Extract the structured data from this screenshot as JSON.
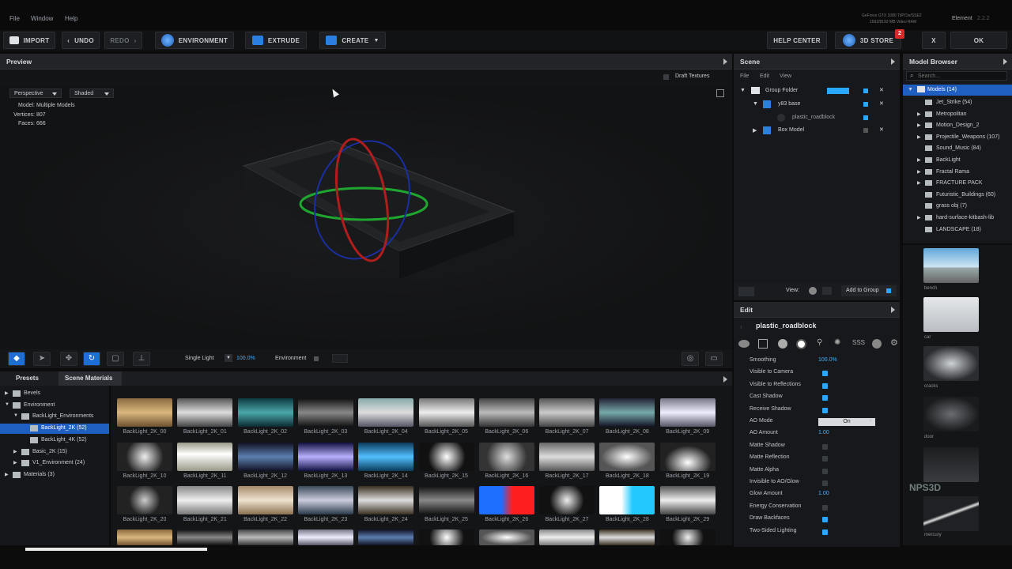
{
  "menu": [
    "File",
    "Window",
    "Help"
  ],
  "top_right": {
    "line1": "GeForce GTX 1080 Ti/PCIe/SSE2",
    "line2": "1592/8192 MB Video RAM",
    "app": "Element",
    "version": "2.2.2"
  },
  "toolbar": {
    "import": "IMPORT",
    "undo": "UNDO",
    "redo": "REDO",
    "environment": "ENVIRONMENT",
    "extrude": "EXTRUDE",
    "create": "CREATE",
    "help_center": "HELP CENTER",
    "store": "3D STORE",
    "store_badge": "2",
    "close": "X",
    "ok": "OK"
  },
  "preview": {
    "title": "Preview",
    "draft_textures": "Draft Textures",
    "view_mode": "Perspective",
    "shading": "Shaded",
    "stats": [
      {
        "k": "Model:",
        "v": "Multiple Models"
      },
      {
        "k": "Vertices:",
        "v": "807"
      },
      {
        "k": "Faces:",
        "v": "666"
      }
    ]
  },
  "viewbar": {
    "light": "Single Light",
    "light_pct": "100.0%",
    "env_label": "Environment"
  },
  "presets": {
    "tab_presets": "Presets",
    "tab_materials": "Scene Materials",
    "tree": [
      {
        "label": "Bevels",
        "depth": 0
      },
      {
        "label": "Environment",
        "depth": 0
      },
      {
        "label": "BackLight_Environments",
        "depth": 1
      },
      {
        "label": "BackLight_2K (52)",
        "depth": 2,
        "selected": true
      },
      {
        "label": "BackLight_4K (52)",
        "depth": 2
      },
      {
        "label": "Basic_2K (15)",
        "depth": 1
      },
      {
        "label": "V1_Environment (24)",
        "depth": 1
      },
      {
        "label": "Materials (3)",
        "depth": 0
      }
    ]
  },
  "thumbnails": [
    "BackLight_2K_00",
    "BackLight_2K_01",
    "BackLight_2K_02",
    "BackLight_2K_03",
    "BackLight_2K_04",
    "BackLight_2K_05",
    "BackLight_2K_06",
    "BackLight_2K_07",
    "BackLight_2K_08",
    "BackLight_2K_09",
    "BackLight_2K_10",
    "BackLight_2K_11",
    "BackLight_2K_12",
    "BackLight_2K_13",
    "BackLight_2K_14",
    "BackLight_2K_15",
    "BackLight_2K_16",
    "BackLight_2K_17",
    "BackLight_2K_18",
    "BackLight_2K_19",
    "BackLight_2K_20",
    "BackLight_2K_21",
    "BackLight_2K_22",
    "BackLight_2K_23",
    "BackLight_2K_24",
    "BackLight_2K_25",
    "BackLight_2K_26",
    "BackLight_2K_27",
    "BackLight_2K_28",
    "BackLight_2K_29"
  ],
  "scene": {
    "title": "Scene",
    "menu": [
      "File",
      "Edit",
      "View"
    ],
    "items": [
      {
        "label": "Group Folder",
        "depth": 0
      },
      {
        "label": "y83 base",
        "depth": 1
      },
      {
        "label": "plastic_roadblock",
        "depth": 2
      },
      {
        "label": "Box Model",
        "depth": 1
      }
    ],
    "view_label": "View:",
    "add_group": "Add to Group"
  },
  "edit": {
    "title": "Edit",
    "object": "plastic_roadblock",
    "props": [
      {
        "label": "Smoothing",
        "value": "100.0%"
      },
      {
        "label": "Visible to Camera",
        "check": true
      },
      {
        "label": "Visible to Reflections",
        "check": true
      },
      {
        "label": "Cast Shadow",
        "check": true
      },
      {
        "label": "Receive Shadow",
        "check": true
      },
      {
        "label": "AO Mode",
        "select": "On"
      },
      {
        "label": "AO Amount",
        "value": "1.00"
      },
      {
        "label": "Matte Shadow",
        "check": false
      },
      {
        "label": "Matte Reflection",
        "check": false
      },
      {
        "label": "Matte Alpha",
        "check": false
      },
      {
        "label": "Invisible to AO/Glow",
        "check": false
      },
      {
        "label": "Glow Amount",
        "value": "1.00"
      },
      {
        "label": "Energy Conservation",
        "check": false
      },
      {
        "label": "Draw Backfaces",
        "check": true
      },
      {
        "label": "Two-Sided Lighting",
        "check": true
      }
    ]
  },
  "model_browser": {
    "title": "Model Browser",
    "search_placeholder": "Search...",
    "root": "Models (14)",
    "items": [
      "Jet_Strike (54)",
      "Metropolitan",
      "Motion_Design_2",
      "Projectile_Weapons (107)",
      "Sound_Music (84)",
      "BackLight",
      "Fractal Rama",
      "FRACTURE PACK",
      "Futuristic_Buildings (60)",
      "grass obj (7)",
      "hard-surface-kitbash-lib",
      "LANDSCAPE (18)"
    ],
    "thumbs": [
      "bench",
      "car",
      "cracks",
      "door",
      "",
      "mercury"
    ]
  },
  "colors": {
    "accent": "#2aa7ff",
    "selected": "#1f5fbf",
    "store_badge": "#d92a2a"
  }
}
